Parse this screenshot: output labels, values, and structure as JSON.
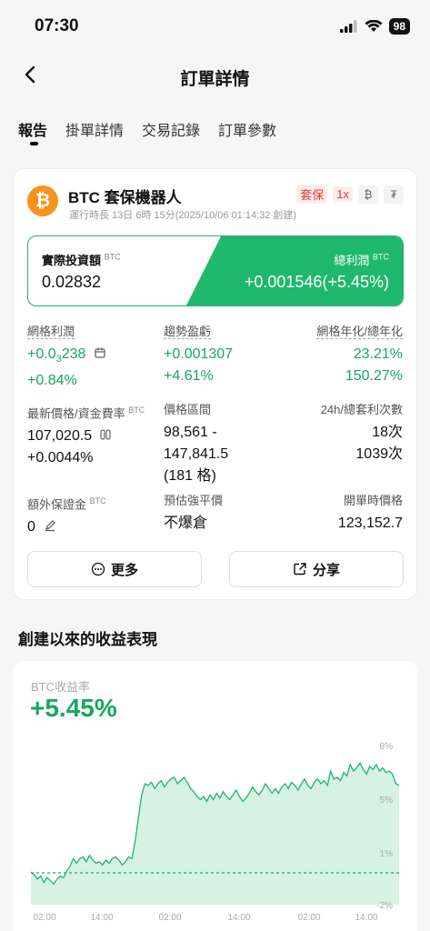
{
  "status": {
    "time": "07:30",
    "battery": "98"
  },
  "nav": {
    "title": "訂單詳情"
  },
  "tabs": [
    "報告",
    "掛單詳情",
    "交易記錄",
    "訂單參數"
  ],
  "bot": {
    "coin_symbol": "₿",
    "name": "BTC 套保機器人",
    "runtime": "運行時長 13日 6時 15分(2025/10/06 01:14:32 創建)",
    "tag_hedge": "套保",
    "tag_leverage": "1x",
    "icon_btc": "₿",
    "icon_usdt": "₮"
  },
  "investment": {
    "label": "實際投資額",
    "unit": "BTC",
    "value": "0.02832"
  },
  "total_profit": {
    "label": "總利潤",
    "unit": "BTC",
    "value": "+0.001546(+5.45%)"
  },
  "stats": {
    "grid_profit": {
      "label": "網格利潤",
      "value_prefix": "+0.0",
      "value_sub": "3",
      "value_suffix": "238",
      "percent": "+0.84%"
    },
    "trend_pnl": {
      "label": "趨勢盈虧",
      "value": "+0.001307",
      "percent": "+4.61%"
    },
    "grid_annual": {
      "label": "網格年化/總年化",
      "value": "23.21%",
      "percent": "150.27%"
    },
    "last_price": {
      "label": "最新價格/資金費率",
      "unit": "BTC",
      "value": "107,020.5",
      "percent": "+0.0044%"
    },
    "price_range": {
      "label": "價格區間",
      "line1": "98,561 -",
      "line2": "147,841.5",
      "line3": "(181 格)"
    },
    "arbitrage": {
      "label": "24h/總套利次數",
      "value": "18次",
      "total": "1039次"
    },
    "extra_margin": {
      "label": "額外保證金",
      "unit": "BTC",
      "value": "0"
    },
    "liq_price": {
      "label": "預估強平價",
      "value": "不爆倉"
    },
    "open_price": {
      "label": "開單時價格",
      "value": "123,152.7"
    }
  },
  "buttons": {
    "more": "更多",
    "share": "分享"
  },
  "section_title": "創建以來的收益表現",
  "chart_data": {
    "type": "area",
    "title": "BTC收益率",
    "headline": "+5.45%",
    "y_ticks": [
      "8%",
      "5%",
      "1%",
      "-2%"
    ],
    "x_ticks": [
      "02:00",
      "14:00",
      "02:00",
      "14:00",
      "02:00",
      "14:00"
    ],
    "ylim": [
      -2,
      8
    ],
    "baseline": 0,
    "series": [
      {
        "values": [
          0.05,
          -0.1,
          -0.4,
          -0.2,
          -0.6,
          -0.3,
          -0.5,
          -0.7,
          -0.4,
          -0.2,
          -0.3,
          0.1,
          0.4,
          0.9,
          0.6,
          0.9,
          1.0,
          0.7,
          1.1,
          0.8,
          0.6,
          0.7,
          0.5,
          0.8,
          0.6,
          0.9,
          1.0,
          0.8,
          0.5,
          0.7,
          1.0,
          0.9,
          2.0,
          3.5,
          4.9,
          5.6,
          5.5,
          5.7,
          5.3,
          5.6,
          5.8,
          5.4,
          5.7,
          5.9,
          6.0,
          5.6,
          5.8,
          6.0,
          5.7,
          5.3,
          5.1,
          4.8,
          4.6,
          4.8,
          4.5,
          4.9,
          4.6,
          5.0,
          4.7,
          5.1,
          4.8,
          4.6,
          4.9,
          5.2,
          4.8,
          4.5,
          4.7,
          5.0,
          5.4,
          5.1,
          4.9,
          5.2,
          5.6,
          5.3,
          5.0,
          5.3,
          5.0,
          5.4,
          5.6,
          5.3,
          5.7,
          5.5,
          5.2,
          5.6,
          5.9,
          5.5,
          5.3,
          5.7,
          5.9,
          5.6,
          5.8,
          5.5,
          6.4,
          5.9,
          6.0,
          5.8,
          6.3,
          6.1,
          6.8,
          6.4,
          6.6,
          6.9,
          6.5,
          6.2,
          6.7,
          6.5,
          6.8,
          6.4,
          6.6,
          6.3,
          6.4,
          6.2,
          5.6,
          5.5
        ]
      }
    ],
    "colors": {
      "line": "#1fb56c",
      "fill": "#d6f2e3",
      "baseline": "#16a85f"
    }
  }
}
